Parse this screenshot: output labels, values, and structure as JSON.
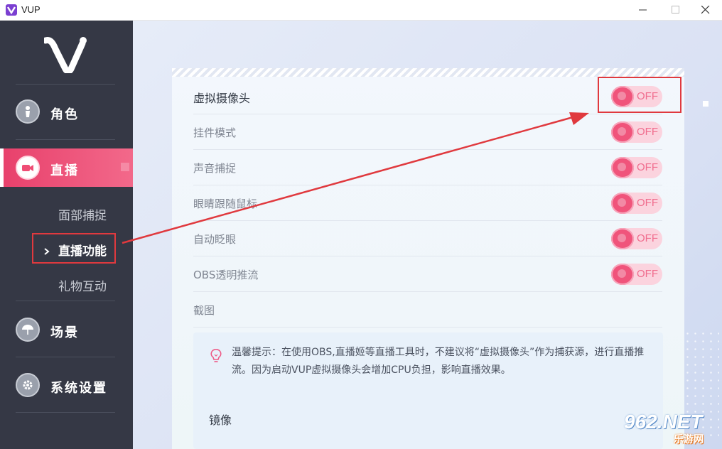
{
  "window": {
    "title": "VUP",
    "controls": {
      "minimize_icon": "minimize-icon",
      "maximize_icon": "maximize-icon",
      "close_icon": "close-icon"
    }
  },
  "sidebar": {
    "items": [
      {
        "label": "角色",
        "icon": "character-icon"
      },
      {
        "label": "直播",
        "icon": "live-camera-icon",
        "active": true
      },
      {
        "label": "场景",
        "icon": "umbrella-scene-icon"
      },
      {
        "label": "系统设置",
        "icon": "gear-icon"
      }
    ],
    "sub_items": [
      {
        "label": "面部捕捉"
      },
      {
        "label": "直播功能",
        "selected": true
      },
      {
        "label": "礼物互动"
      }
    ]
  },
  "main": {
    "settings": [
      {
        "label": "虚拟摄像头",
        "state": "OFF"
      },
      {
        "label": "挂件模式",
        "state": "OFF"
      },
      {
        "label": "声音捕捉",
        "state": "OFF"
      },
      {
        "label": "眼睛跟随鼠标",
        "state": "OFF"
      },
      {
        "label": "自动眨眼",
        "state": "OFF"
      },
      {
        "label": "OBS透明推流",
        "state": "OFF"
      },
      {
        "label": "截图"
      }
    ],
    "tip": {
      "icon": "lightbulb-icon",
      "text": "温馨提示：在使用OBS,直播姬等直播工具时，不建议将“虚拟摄像头”作为捕获源，进行直播推流。因为启动VUP虚拟摄像头会增加CPU负担，影响直播效果。"
    },
    "mirror_label": "镜像"
  },
  "watermark": {
    "number": "962.NET",
    "sub": "乐游网"
  },
  "colors": {
    "sidebar_bg": "#353845",
    "accent": "#f0547b",
    "annotation_red": "#e0393e"
  }
}
